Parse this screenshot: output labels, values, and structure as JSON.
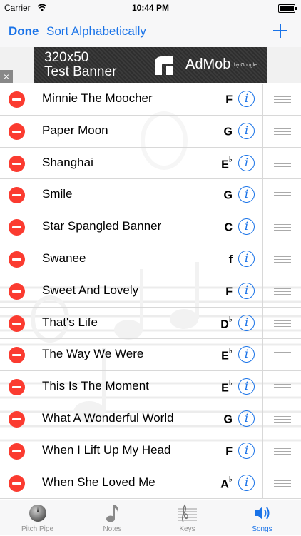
{
  "status_bar": {
    "carrier": "Carrier",
    "time": "10:44 PM"
  },
  "nav": {
    "done_label": "Done",
    "sort_label": "Sort Alphabetically",
    "add_icon": "plus-icon"
  },
  "ad": {
    "title_line1": "320x50",
    "title_line2": "Test Banner",
    "brand": "AdMob",
    "by": "by Google",
    "close": "×"
  },
  "songs": [
    {
      "title": "Minnie The Moocher",
      "key": "F",
      "accidental": ""
    },
    {
      "title": "Paper Moon",
      "key": "G",
      "accidental": ""
    },
    {
      "title": "Shanghai",
      "key": "E",
      "accidental": "♭"
    },
    {
      "title": "Smile",
      "key": "G",
      "accidental": ""
    },
    {
      "title": "Star Spangled Banner",
      "key": "C",
      "accidental": ""
    },
    {
      "title": "Swanee",
      "key": "f",
      "accidental": ""
    },
    {
      "title": "Sweet And Lovely",
      "key": "F",
      "accidental": ""
    },
    {
      "title": "That's Life",
      "key": "D",
      "accidental": "♭"
    },
    {
      "title": "The Way We Were",
      "key": "E",
      "accidental": "♭"
    },
    {
      "title": "This Is The Moment",
      "key": "E",
      "accidental": "♭"
    },
    {
      "title": "What A Wonderful World",
      "key": "G",
      "accidental": ""
    },
    {
      "title": "When I Lift Up My Head",
      "key": "F",
      "accidental": ""
    },
    {
      "title": "When She Loved Me",
      "key": "A",
      "accidental": "♭"
    }
  ],
  "tabs": [
    {
      "label": "Pitch Pipe",
      "icon": "pitch-pipe-icon",
      "active": false
    },
    {
      "label": "Notes",
      "icon": "music-note-icon",
      "active": false
    },
    {
      "label": "Keys",
      "icon": "staff-icon",
      "active": false
    },
    {
      "label": "Songs",
      "icon": "speaker-icon",
      "active": true
    }
  ],
  "colors": {
    "accent": "#1a73e8",
    "delete": "#fb3b30",
    "bar_bg": "#f7f7f8"
  }
}
